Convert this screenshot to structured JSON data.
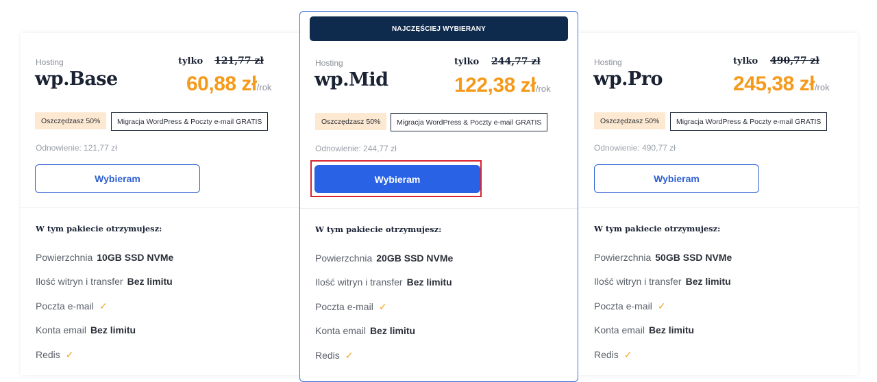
{
  "featured_badge": "NAJCZĘŚCIEJ WYBIERANY",
  "plans": [
    {
      "category": "Hosting",
      "name": "wp.Base",
      "only_label": "tylko",
      "old_price": "121,77 zł",
      "price": "60,88 zł",
      "per": "/rok",
      "save": "Oszczędzasz 50%",
      "migration": "Migracja WordPress & Poczty e-mail GRATIS",
      "renewal": "Odnowienie: 121,77 zł",
      "button": "Wybieram",
      "includes": "W tym pakiecie otrzymujesz:",
      "features": [
        {
          "label": "Powierzchnia",
          "value": "10GB SSD NVMe"
        },
        {
          "label": "Ilość witryn i transfer",
          "value": "Bez limitu"
        },
        {
          "label": "Poczta e-mail",
          "check": "check-icon"
        },
        {
          "label": "Konta email",
          "value": "Bez limitu"
        },
        {
          "label": "Redis",
          "check": "check-icon"
        }
      ]
    },
    {
      "category": "Hosting",
      "name": "wp.Mid",
      "only_label": "tylko",
      "old_price": "244,77 zł",
      "price": "122,38 zł",
      "per": "/rok",
      "save": "Oszczędzasz 50%",
      "migration": "Migracja WordPress & Poczty e-mail GRATIS",
      "renewal": "Odnowienie: 244,77 zł",
      "button": "Wybieram",
      "includes": "W tym pakiecie otrzymujesz:",
      "features": [
        {
          "label": "Powierzchnia",
          "value": "20GB SSD NVMe"
        },
        {
          "label": "Ilość witryn i transfer",
          "value": "Bez limitu"
        },
        {
          "label": "Poczta e-mail",
          "check": "check-icon"
        },
        {
          "label": "Konta email",
          "value": "Bez limitu"
        },
        {
          "label": "Redis",
          "check": "check-icon"
        }
      ]
    },
    {
      "category": "Hosting",
      "name": "wp.Pro",
      "only_label": "tylko",
      "old_price": "490,77 zł",
      "price": "245,38 zł",
      "per": "/rok",
      "save": "Oszczędzasz 50%",
      "migration": "Migracja WordPress & Poczty e-mail GRATIS",
      "renewal": "Odnowienie: 490,77 zł",
      "button": "Wybieram",
      "includes": "W tym pakiecie otrzymujesz:",
      "features": [
        {
          "label": "Powierzchnia",
          "value": "50GB SSD NVMe"
        },
        {
          "label": "Ilość witryn i transfer",
          "value": "Bez limitu"
        },
        {
          "label": "Poczta e-mail",
          "check": "check-icon"
        },
        {
          "label": "Konta email",
          "value": "Bez limitu"
        },
        {
          "label": "Redis",
          "check": "check-icon"
        }
      ]
    }
  ],
  "colors": {
    "accent": "#2a62e6",
    "price": "#f59a1b",
    "badge_bg": "#0e2a4d",
    "highlight": "#d7232f"
  }
}
